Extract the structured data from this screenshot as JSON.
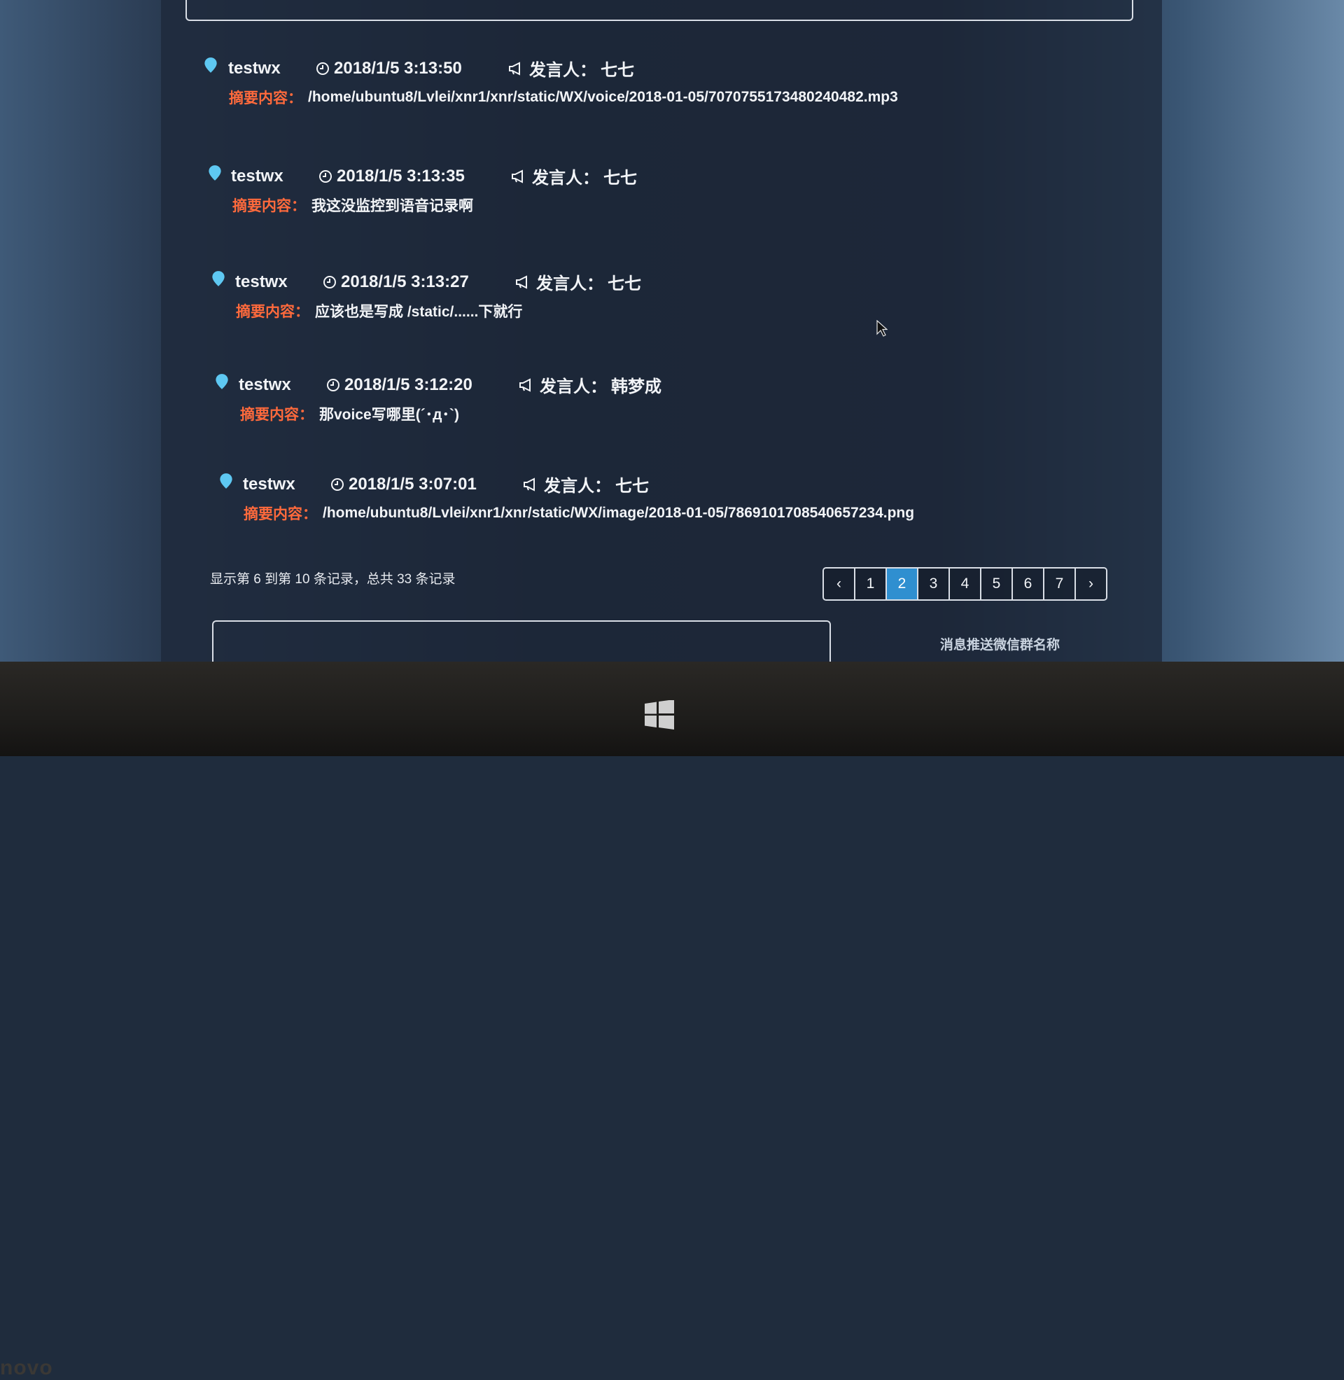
{
  "messages": [
    {
      "group": "testwx",
      "time": "2018/1/5 3:13:50",
      "sender_label": "发言人：",
      "sender": "七七",
      "summary_label": "摘要内容：",
      "summary": "/home/ubuntu8/Lvlei/xnr1/xnr/static/WX/voice/2018-01-05/7070755173480240482.mp3"
    },
    {
      "group": "testwx",
      "time": "2018/1/5 3:13:35",
      "sender_label": "发言人：",
      "sender": "七七",
      "summary_label": "摘要内容：",
      "summary": "我这没监控到语音记录啊"
    },
    {
      "group": "testwx",
      "time": "2018/1/5 3:13:27",
      "sender_label": "发言人：",
      "sender": "七七",
      "summary_label": "摘要内容：",
      "summary": "应该也是写成 /static/......下就行"
    },
    {
      "group": "testwx",
      "time": "2018/1/5 3:12:20",
      "sender_label": "发言人：",
      "sender": "韩梦成",
      "summary_label": "摘要内容：",
      "summary": "那voice写哪里(´･д･`)"
    },
    {
      "group": "testwx",
      "time": "2018/1/5 3:07:01",
      "sender_label": "发言人：",
      "sender": "七七",
      "summary_label": "摘要内容：",
      "summary": "/home/ubuntu8/Lvlei/xnr1/xnr/static/WX/image/2018-01-05/7869101708540657234.png"
    }
  ],
  "footer": {
    "records_text": "显示第 6 到第 10 条记录，总共 33 条记录"
  },
  "pagination": {
    "prev": "‹",
    "pages": [
      "1",
      "2",
      "3",
      "4",
      "5",
      "6",
      "7"
    ],
    "active_page": "2",
    "next": "›"
  },
  "push_section": {
    "label": "消息推送微信群名称"
  },
  "colors": {
    "pin": "#5ec8f2",
    "summary_label": "#ff6a3c",
    "active_page": "#2f8fd0"
  },
  "device": {
    "brand": "novo"
  }
}
